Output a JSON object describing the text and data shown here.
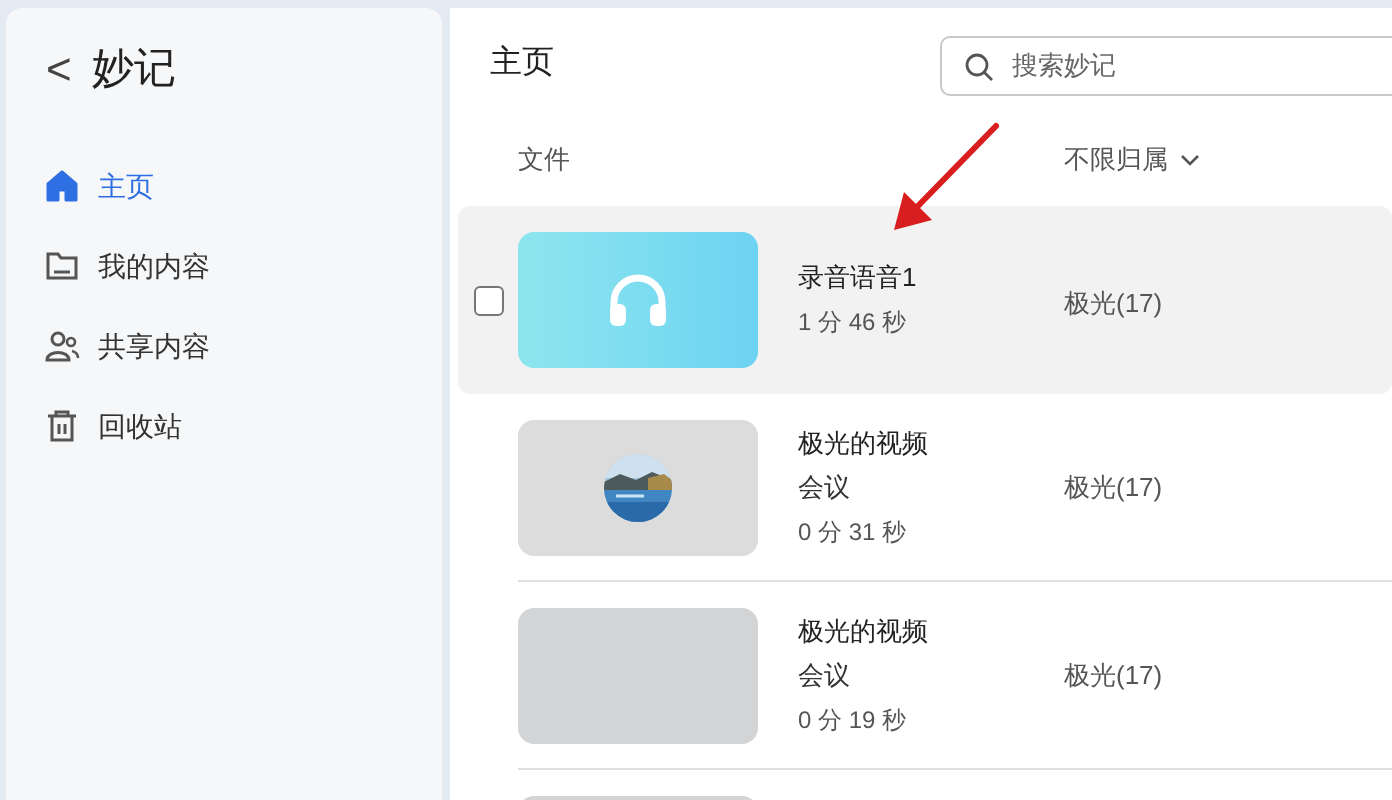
{
  "sidebar": {
    "back": "<",
    "title": "妙记",
    "items": [
      {
        "kind": "home",
        "label": "主页",
        "selected": true
      },
      {
        "kind": "folder",
        "label": "我的内容",
        "selected": false
      },
      {
        "kind": "people",
        "label": "共享内容",
        "selected": false
      },
      {
        "kind": "trash",
        "label": "回收站",
        "selected": false
      }
    ]
  },
  "main": {
    "title": "主页",
    "search": {
      "placeholder": "搜索妙记"
    },
    "columns": [
      {
        "label": "文件",
        "dropdown": false
      },
      {
        "label": "不限归属",
        "dropdown": true
      }
    ],
    "rows": [
      {
        "kind": "audio",
        "title": "录音语音1",
        "duration": "1 分 46 秒",
        "owner": "极光(17)",
        "hovered": true,
        "checkbox": {
          "checked": false
        }
      },
      {
        "kind": "picture",
        "title": "极光的视频",
        "subtitle": "会议",
        "duration": "0 分 31 秒",
        "owner": "极光(17)",
        "hovered": false
      },
      {
        "kind": "blank",
        "title": "极光的视频",
        "subtitle": "会议",
        "duration": "0 分 19 秒",
        "owner": "极光(17)",
        "hovered": false
      },
      {
        "kind": "blank",
        "hovered": false
      }
    ]
  },
  "annotations": [
    {
      "kind": "arrow"
    }
  ]
}
